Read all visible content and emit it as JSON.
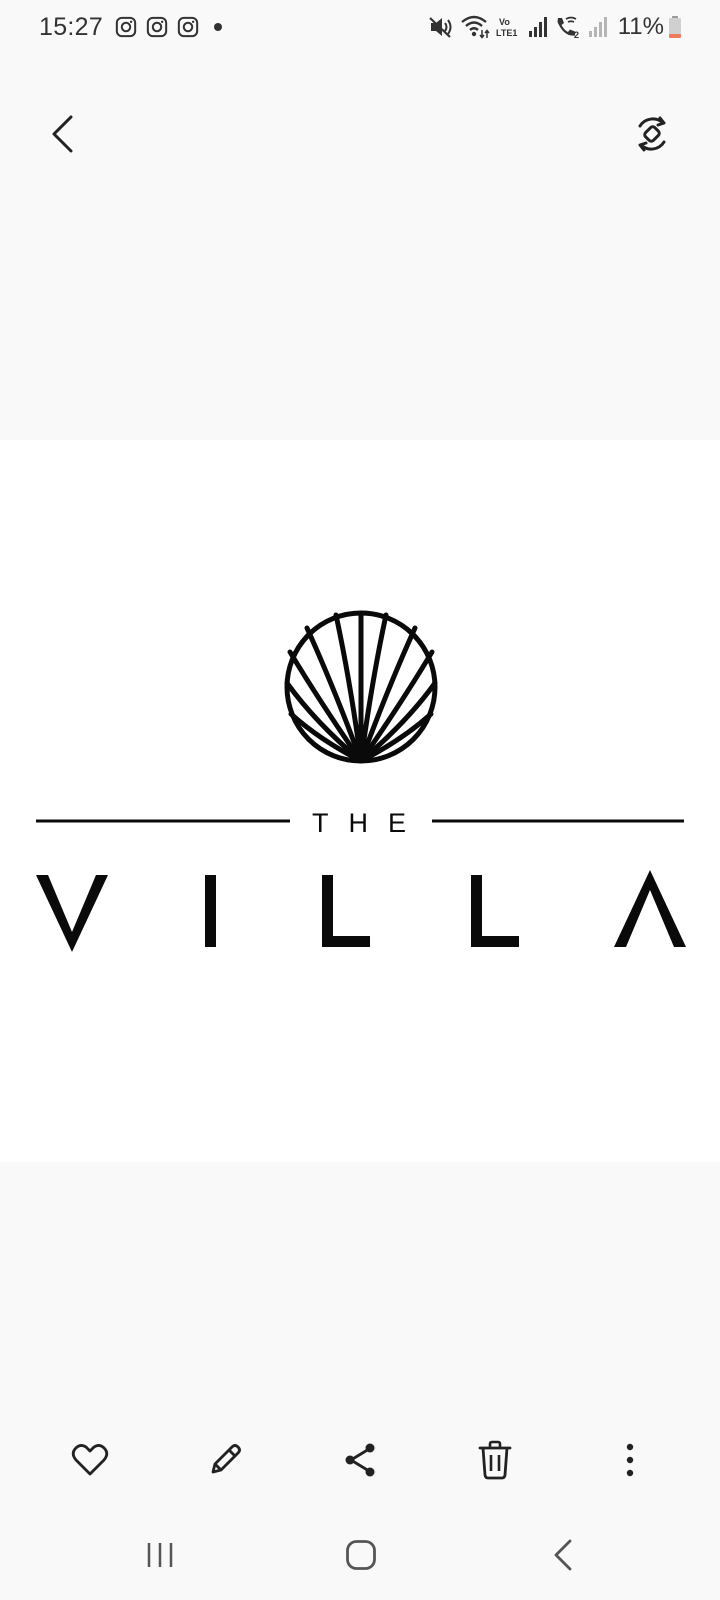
{
  "status_bar": {
    "time": "15:27",
    "notification_icons": [
      "instagram-icon",
      "instagram-icon",
      "instagram-icon"
    ],
    "status_icons": [
      "mute-icon",
      "wifi-icon",
      "volte-lte1-icon",
      "signal-icon",
      "wifi-calling-icon",
      "signal-icon"
    ],
    "volte_label": "Vo",
    "lte_label": "LTE1",
    "sim2_label": "2",
    "battery": "11%",
    "battery_low_color": "#f07a5a"
  },
  "viewer": {
    "icons": [
      "back-chevron-icon",
      "rotate-icon"
    ]
  },
  "image": {
    "logo_small_text": "THE",
    "logo_big_text": "VILLA"
  },
  "toolbar": {
    "icons": [
      "heart-icon",
      "pencil-icon",
      "share-icon",
      "trash-icon",
      "more-vertical-icon"
    ]
  },
  "nav_bar": {
    "icons": [
      "recent-apps-icon",
      "home-icon",
      "back-icon"
    ]
  }
}
